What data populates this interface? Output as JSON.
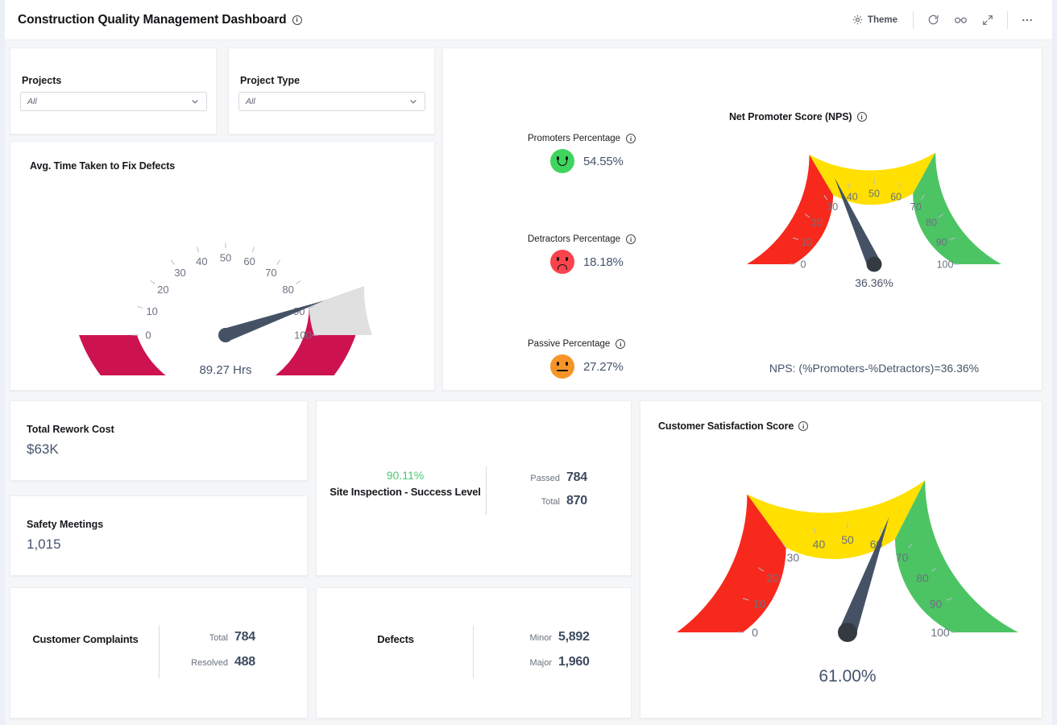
{
  "header": {
    "title": "Construction Quality Management Dashboard",
    "info_icon": "info-icon",
    "theme_label": "Theme",
    "theme_icon": "sun-icon",
    "refresh_icon": "refresh-icon",
    "view_icon": "glasses-icon",
    "expand_icon": "expand-icon",
    "more_icon": "more-options-icon"
  },
  "filters": {
    "projects": {
      "label": "Projects",
      "value": "All"
    },
    "project_type": {
      "label": "Project Type",
      "value": "All"
    }
  },
  "chart_data": [
    {
      "type": "gauge",
      "title": "Avg. Time Taken to Fix Defects",
      "value": 89.27,
      "value_label": "89.27 Hrs",
      "min": 0,
      "max": 100,
      "ticks": [
        0,
        10,
        20,
        30,
        40,
        50,
        60,
        70,
        80,
        90,
        100
      ],
      "bands": [
        {
          "from": 0,
          "to": 89.27,
          "color": "#cc1350"
        },
        {
          "from": 89.27,
          "to": 100,
          "color": "#e0e0e0"
        }
      ]
    },
    {
      "type": "gauge",
      "title": "Net Promoter Score (NPS)",
      "value": 36.36,
      "value_label": "36.36%",
      "min": 0,
      "max": 100,
      "ticks": [
        0,
        10,
        20,
        30,
        40,
        50,
        60,
        70,
        80,
        90,
        100
      ],
      "bands": [
        {
          "from": 0,
          "to": 33,
          "color": "#f7291d"
        },
        {
          "from": 33,
          "to": 66,
          "color": "#ffe000"
        },
        {
          "from": 66,
          "to": 100,
          "color": "#4cc464"
        }
      ],
      "annotation": "NPS: (%Promoters-%Detractors)=36.36%"
    },
    {
      "type": "gauge",
      "title": "Customer Satisfaction Score",
      "value": 61.0,
      "value_label": "61.00%",
      "min": 0,
      "max": 100,
      "ticks": [
        0,
        10,
        20,
        30,
        40,
        50,
        60,
        70,
        80,
        90,
        100
      ],
      "bands": [
        {
          "from": 0,
          "to": 30,
          "color": "#f7291d"
        },
        {
          "from": 30,
          "to": 65,
          "color": "#ffe000"
        },
        {
          "from": 65,
          "to": 100,
          "color": "#4cc464"
        }
      ]
    }
  ],
  "nps_breakdown": [
    {
      "label": "Promoters Percentage",
      "value": "54.55%",
      "face": "smiley-face-icon",
      "mood": "green"
    },
    {
      "label": "Detractors Percentage",
      "value": "18.18%",
      "face": "frowning-face-icon",
      "mood": "red"
    },
    {
      "label": "Passive Percentage",
      "value": "27.27%",
      "face": "neutral-face-icon",
      "mood": "orange"
    }
  ],
  "kpis": [
    {
      "label": "Total Rework Cost",
      "value": "$63K"
    },
    {
      "label": "Safety Meetings",
      "value": "1,015"
    }
  ],
  "site_inspection": {
    "percent": "90.11%",
    "name": "Site Inspection - Success Level",
    "metrics": [
      {
        "key": "Passed",
        "value": "784"
      },
      {
        "key": "Total",
        "value": "870"
      }
    ]
  },
  "customer_complaints": {
    "name": "Customer Complaints",
    "metrics": [
      {
        "key": "Total",
        "value": "784"
      },
      {
        "key": "Resolved",
        "value": "488"
      }
    ]
  },
  "defects": {
    "name": "Defects",
    "metrics": [
      {
        "key": "Minor",
        "value": "5,892"
      },
      {
        "key": "Major",
        "value": "1,960"
      }
    ]
  },
  "colors": {
    "crimson": "#cc1350",
    "red": "#f7291d",
    "yellow": "#ffe000",
    "green": "#4cc464",
    "grey_band": "#e0e0e0",
    "needle": "#455265",
    "value_text": "#46536b",
    "success": "#4bc86f"
  }
}
